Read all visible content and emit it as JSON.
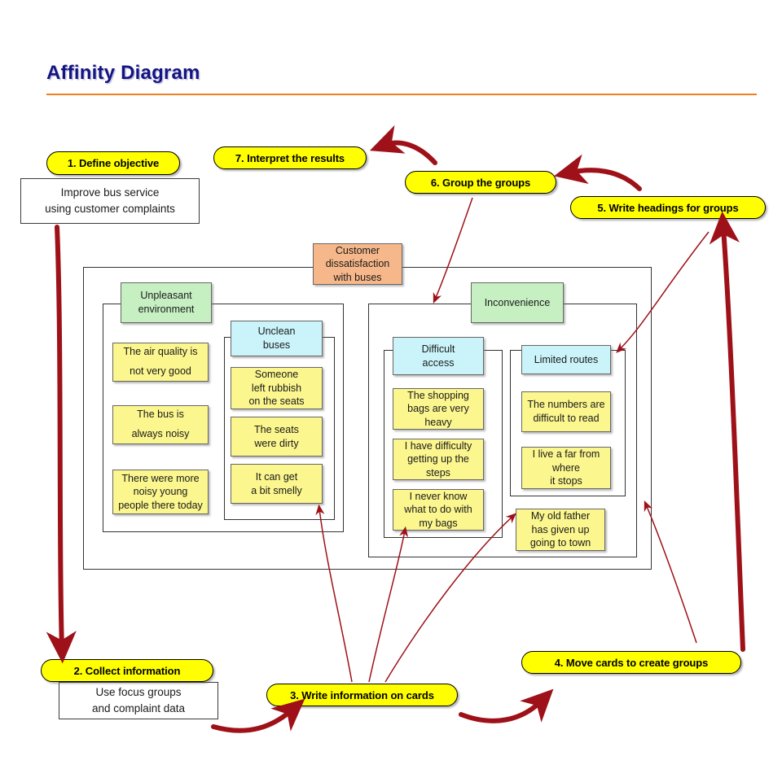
{
  "page": {
    "title": "Affinity Diagram",
    "accent_color": "#ef7f1f",
    "title_color": "#141482",
    "arrow_color": "#9e1118",
    "pill_color": "#ffff00"
  },
  "steps": [
    {
      "id": "step-1",
      "label": "1. Define objective"
    },
    {
      "id": "step-2",
      "label": "2. Collect information"
    },
    {
      "id": "step-3",
      "label": "3. Write information on cards"
    },
    {
      "id": "step-4",
      "label": "4. Move cards to create groups"
    },
    {
      "id": "step-5",
      "label": "5. Write headings for groups"
    },
    {
      "id": "step-6",
      "label": "6. Group the groups"
    },
    {
      "id": "step-7",
      "label": "7. Interpret the results"
    }
  ],
  "notes": [
    {
      "id": "objective-note",
      "line1": "Improve bus service",
      "line2": "using customer complaints"
    },
    {
      "id": "collect-note",
      "line1": "Use focus groups",
      "line2": "and complaint data"
    }
  ],
  "diagram": {
    "topic": {
      "line1": "Customer",
      "line2": "dissatisfaction",
      "line3": "with buses"
    },
    "groups": [
      {
        "id": "group-unpleasant",
        "heading": {
          "line1": "Unpleasant",
          "line2": "environment"
        },
        "loose_notes": [
          {
            "line1": "The air quality is",
            "line2": "not very good"
          },
          {
            "line1": "The bus is",
            "line2": "always noisy"
          },
          {
            "line1": "There were more",
            "line2": "noisy young",
            "line3": "people there today"
          }
        ],
        "subgroups": [
          {
            "id": "subgroup-unclean-buses",
            "heading": {
              "line1": "Unclean",
              "line2": "buses"
            },
            "notes": [
              {
                "line1": "Someone",
                "line2": "left rubbish",
                "line3": "on the seats"
              },
              {
                "line1": "The seats",
                "line2": "were dirty"
              },
              {
                "line1": "It can get",
                "line2": "a bit smelly"
              }
            ]
          }
        ]
      },
      {
        "id": "group-inconvenience",
        "heading": {
          "line1": "Inconvenience"
        },
        "loose_notes": [
          {
            "line1": "My old father",
            "line2": "has given up",
            "line3": "going to town"
          }
        ],
        "subgroups": [
          {
            "id": "subgroup-difficult-access",
            "heading": {
              "line1": "Difficult",
              "line2": "access"
            },
            "notes": [
              {
                "line1": "The shopping",
                "line2": "bags are very",
                "line3": "heavy"
              },
              {
                "line1": "I have difficulty",
                "line2": "getting up the",
                "line3": "steps"
              },
              {
                "line1": "I never know",
                "line2": "what to do with",
                "line3": "my bags"
              }
            ]
          },
          {
            "id": "subgroup-limited-routes",
            "heading": {
              "line1": "Limited routes"
            },
            "notes": [
              {
                "line1": "The numbers are",
                "line2": "difficult to read"
              },
              {
                "line1": "I live a far from",
                "line2": "where",
                "line3": "it stops"
              }
            ]
          }
        ]
      }
    ]
  },
  "colors": {
    "topic_card": "#f6b78a",
    "heading_card": "#c6f0c2",
    "subheading_card": "#caf4fa",
    "note_card": "#fbf68e"
  }
}
